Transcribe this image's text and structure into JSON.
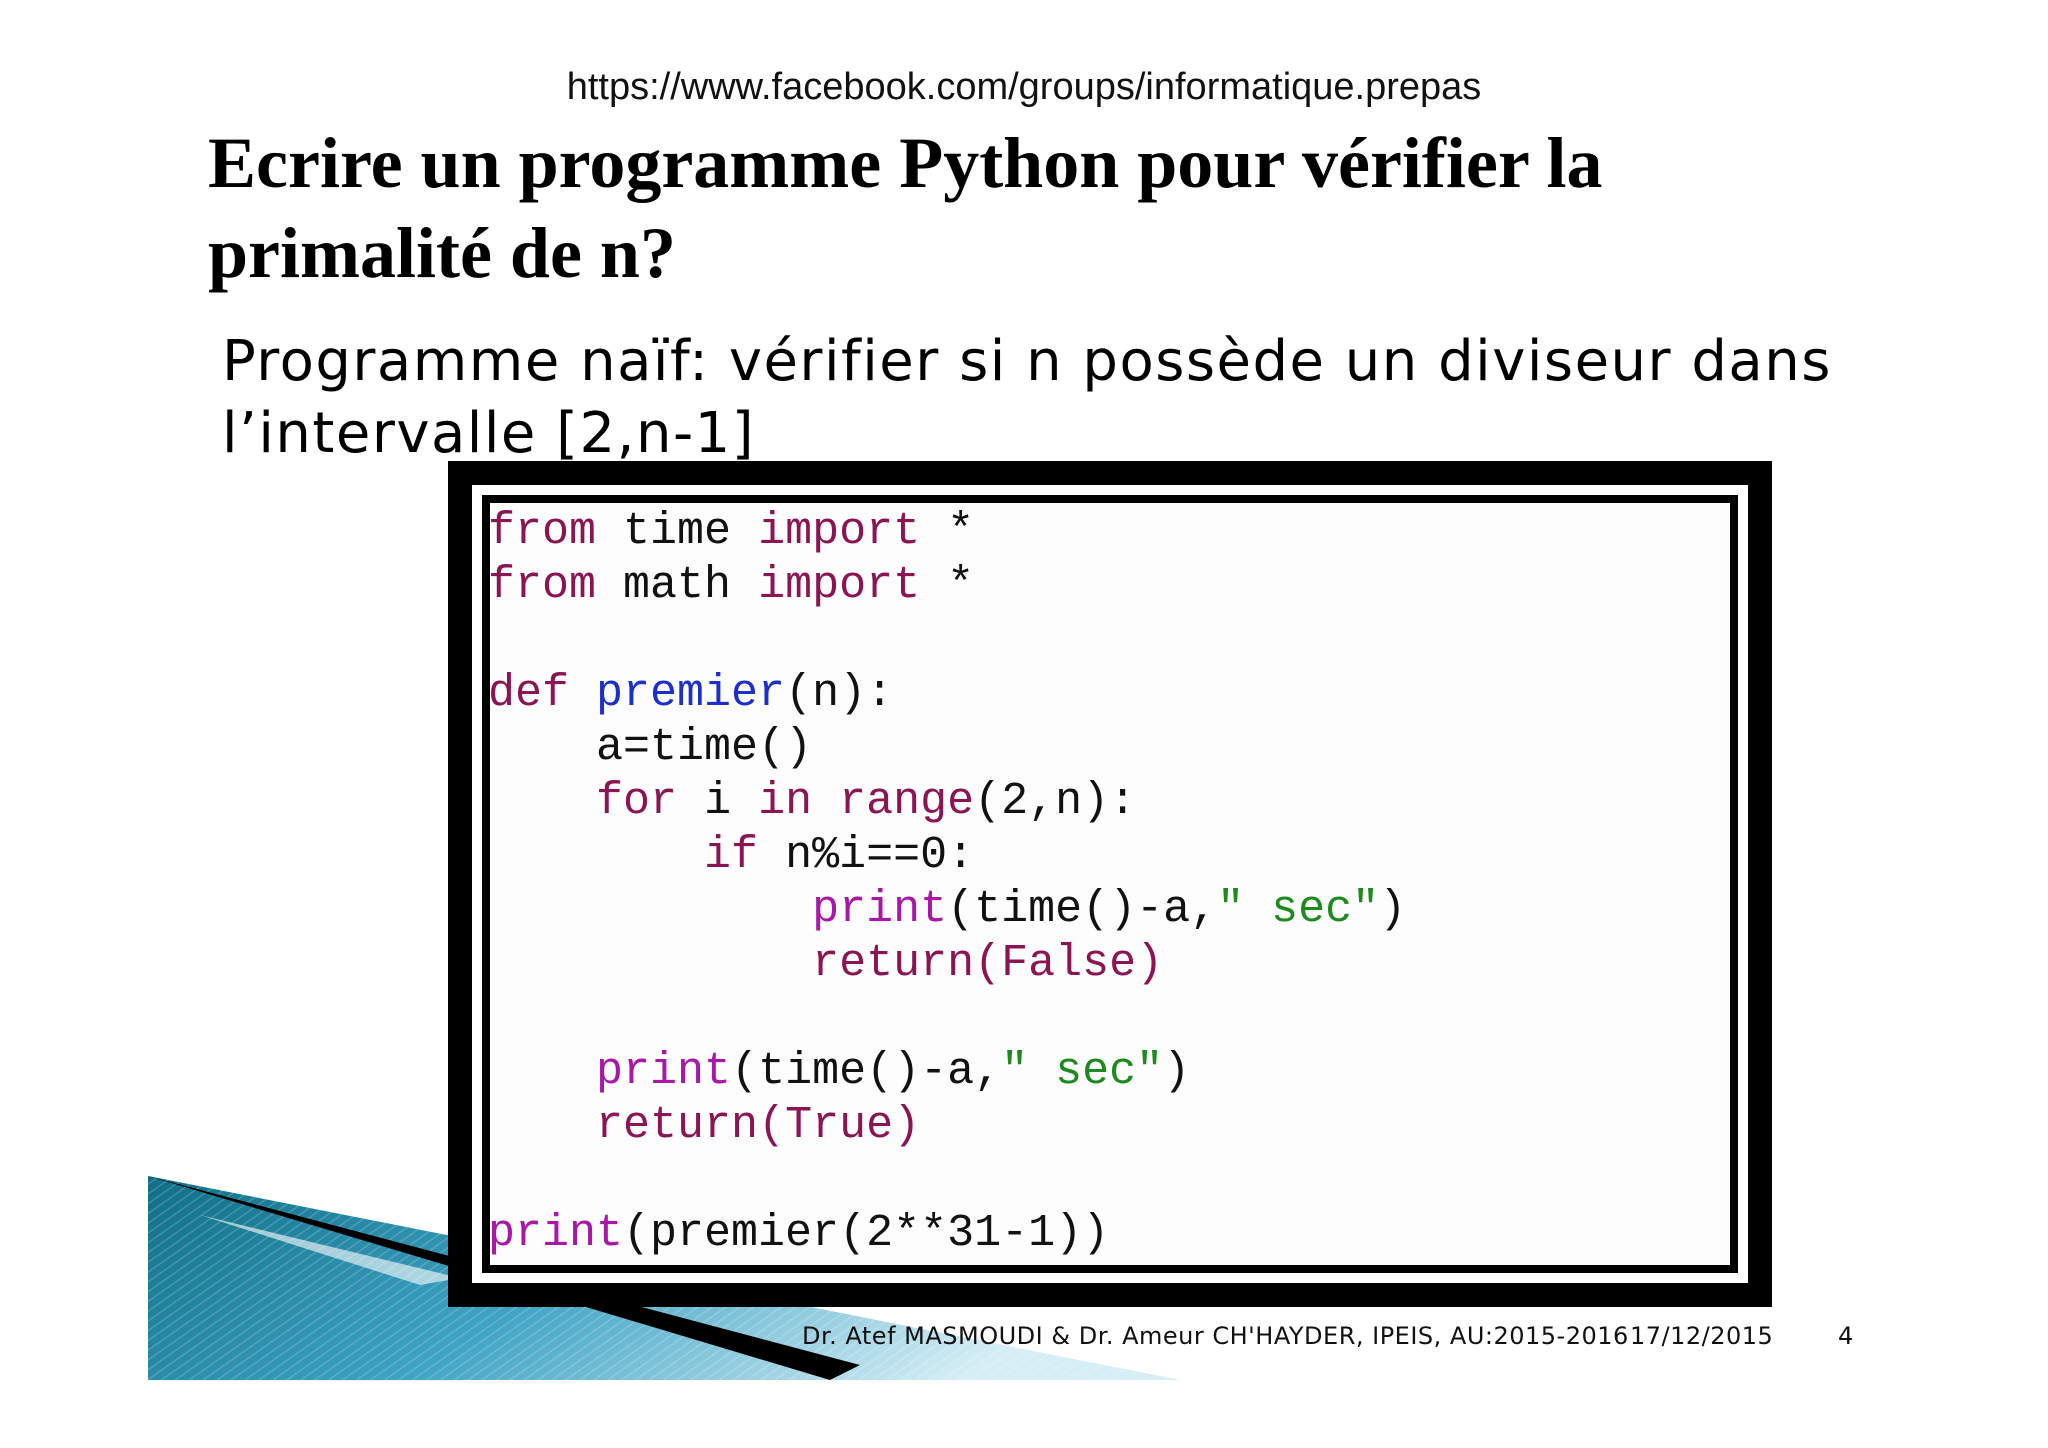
{
  "header": {
    "url": "https://www.facebook.com/groups/informatique.prepas"
  },
  "slide": {
    "title_line1": "Ecrire un programme Python pour vérifier la",
    "title_line2": "primalité de n?",
    "subtitle_line1": "Programme naïf: vérifier si n possède un diviseur dans",
    "subtitle_line2": "l’intervalle [2,n-1]"
  },
  "code": {
    "from1": "from",
    "mod1": "time",
    "import1": "import",
    "star1": "*",
    "from2": "from",
    "mod2": "math",
    "import2": "import",
    "star2": "*",
    "def": "def",
    "fname": "premier",
    "params": "(n):",
    "assign": "a=time()",
    "for": "for",
    "loopvar": "i",
    "in": "in",
    "range": "range",
    "rangeargs": "(2,n):",
    "if": "if",
    "cond": "n%i==0:",
    "print1": "print",
    "print1_args_a": "(time()-a,",
    "str1": "\" sec\"",
    "close1": ")",
    "return1": "return",
    "ret1val": "(False)",
    "print2": "print",
    "print2_args_a": "(time()-a,",
    "str2": "\" sec\"",
    "close2": ")",
    "return2": "return",
    "ret2val": "(True)",
    "print3": "print",
    "call3": "(premier(2**31-1))"
  },
  "footer": {
    "authors": "Dr. Atef MASMOUDI & Dr. Ameur CH'HAYDER, IPEIS, AU:2015-2016",
    "date": "17/12/2015",
    "page": "4"
  },
  "colors": {
    "keyword": "#8b1553",
    "function_name": "#1c2fc9",
    "builtin": "#a817a8",
    "string": "#1c8a1c",
    "decor_teal": "#1a7f96"
  }
}
